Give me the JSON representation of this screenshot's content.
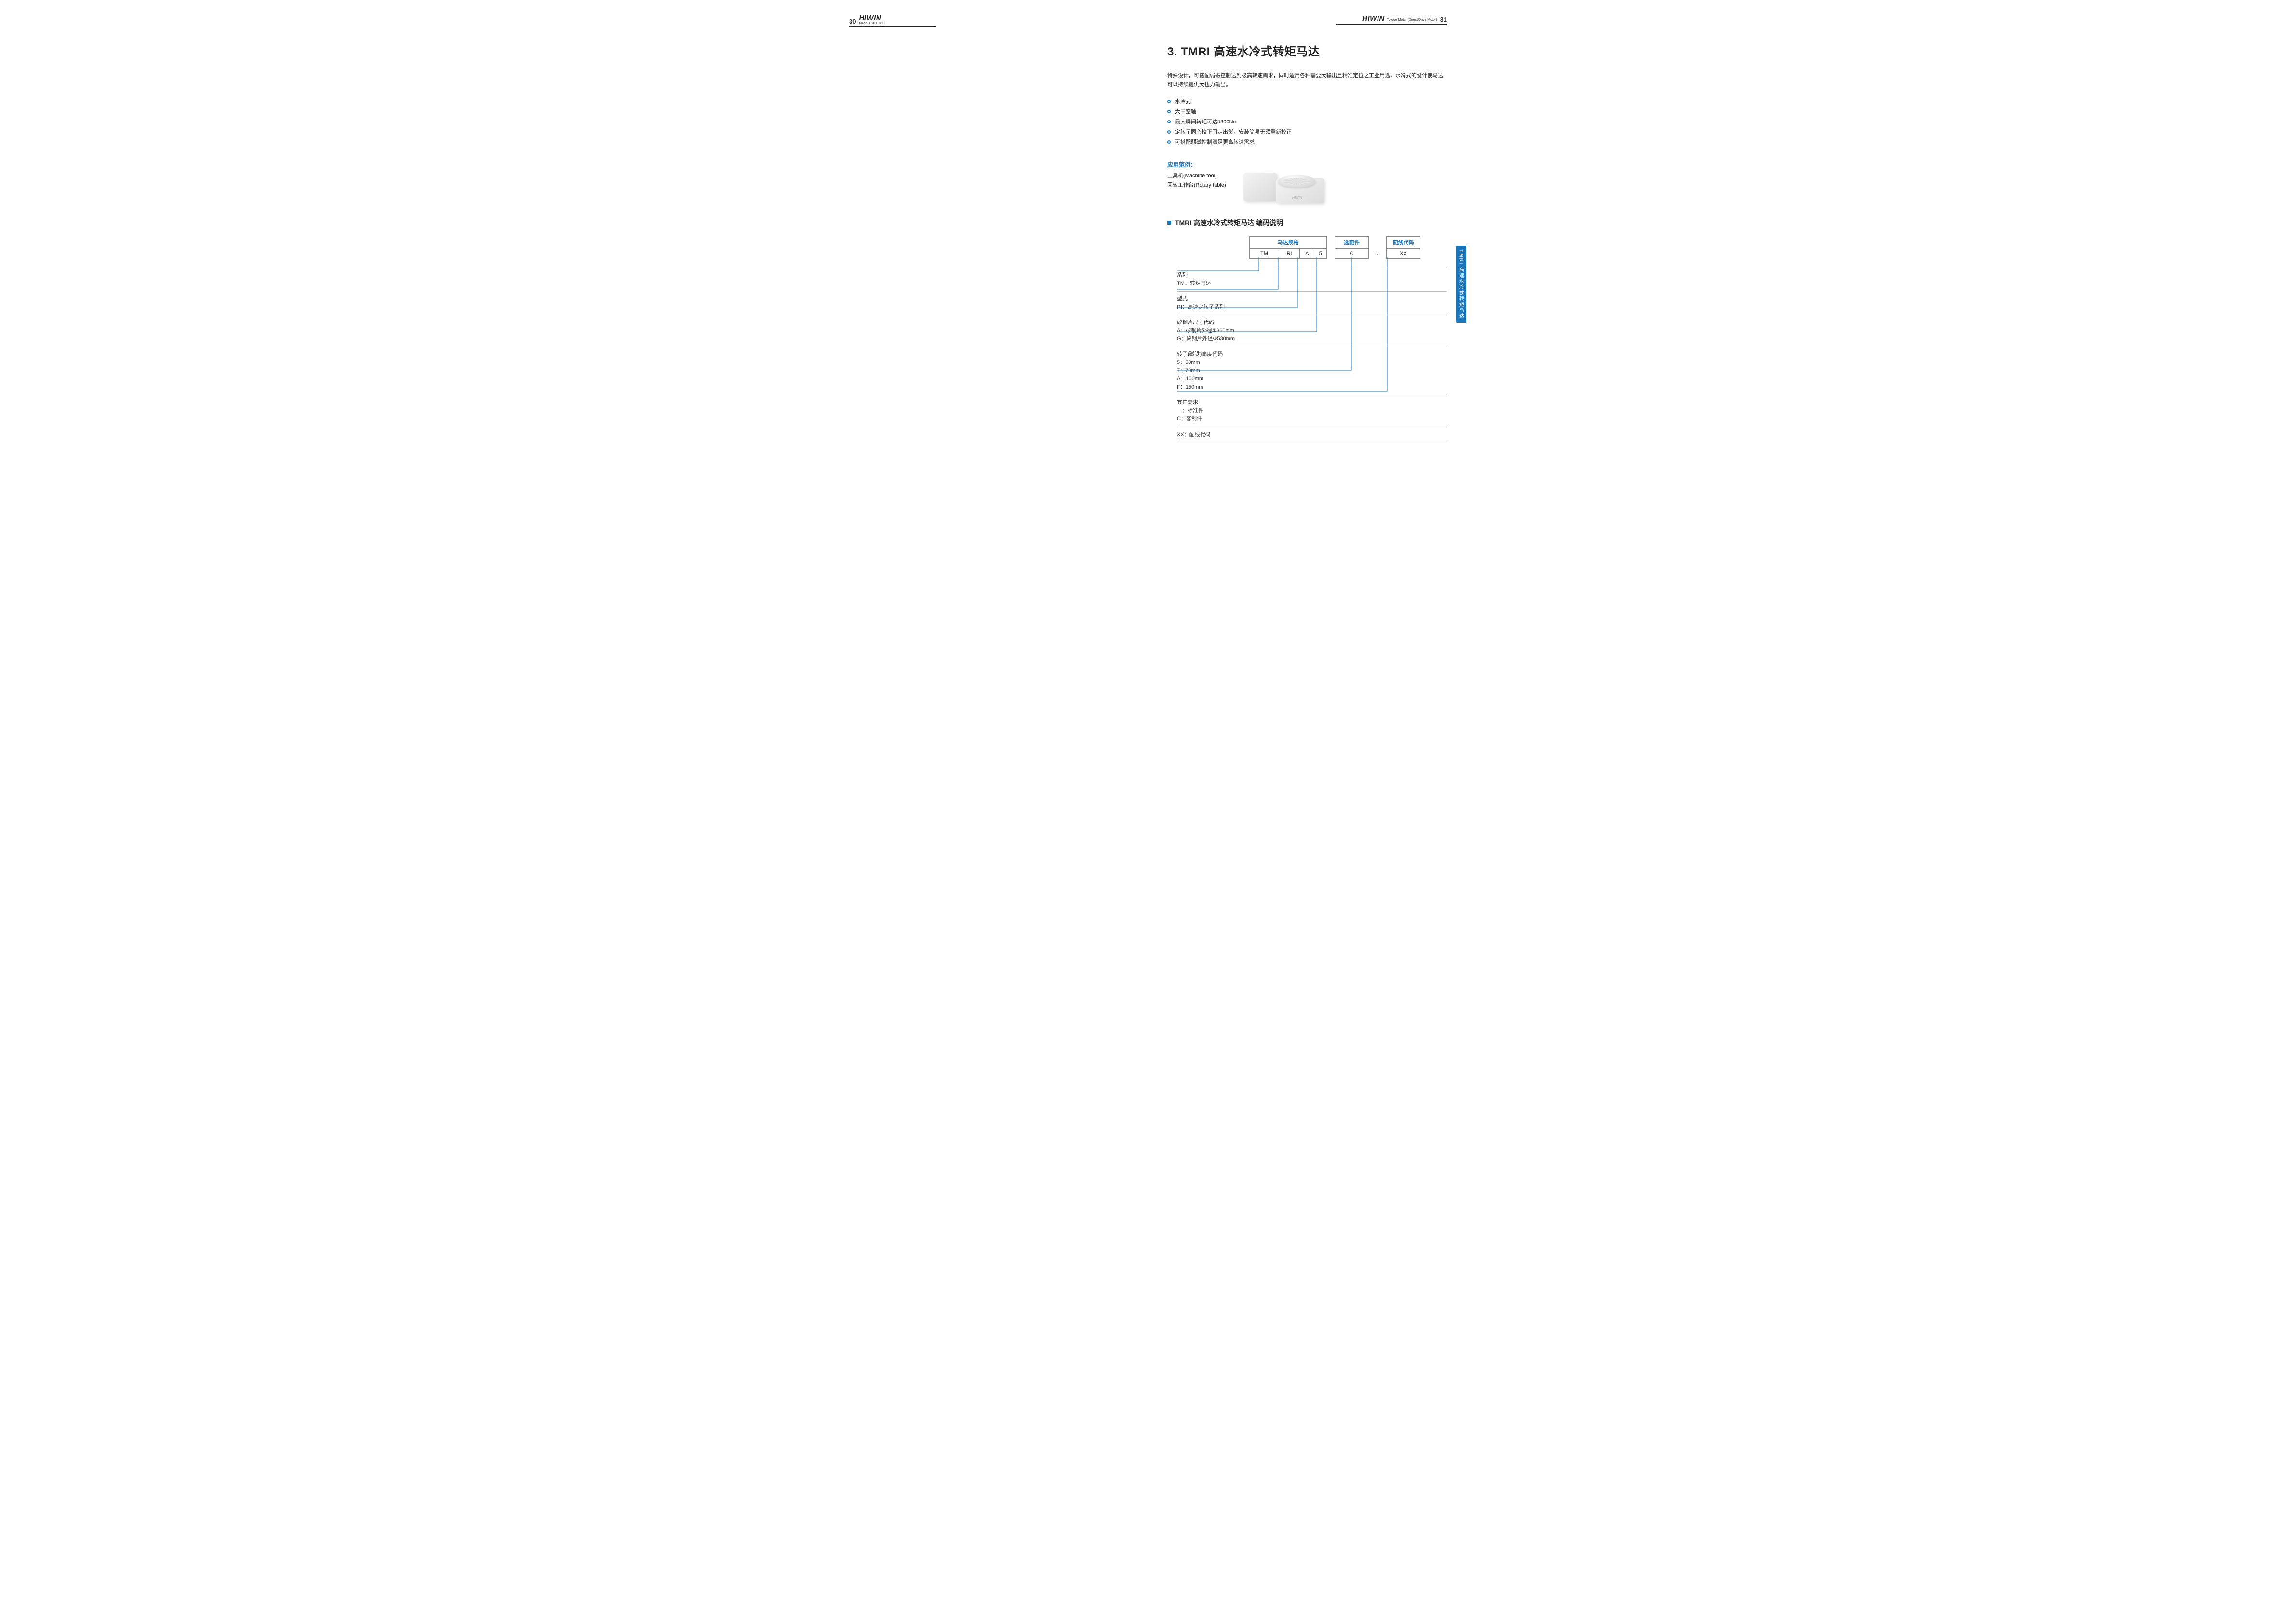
{
  "brand": "HIWIN",
  "left": {
    "page_num": "30",
    "doc_code": "MR99TS01-1800"
  },
  "right": {
    "page_num": "31",
    "subtitle": "Torque Motor (Direct Drive Motor)"
  },
  "section": {
    "title": "3. TMRI 高速水冷式转矩马达",
    "lead": "特殊设计，可搭配弱磁控制达到极高转速需求，同时适用各种需要大输出且精准定位之工业用途，水冷式的设计使马达可以持续提供大扭力输出。",
    "bullets": [
      "水冷式",
      "大中空轴",
      "最大瞬间转矩可达5300Nm",
      "定转子同心校正固定出货，安装简易无须重新校正",
      "可搭配弱磁控制满足更高转速需求"
    ]
  },
  "application": {
    "heading": "应用范例：",
    "lines": [
      "工具机(Machine tool)",
      "回转工作台(Rotary table)"
    ],
    "illus_label": "HIWIN"
  },
  "coding": {
    "subhead": "TMRI 高速水冷式转矩马达 编码说明",
    "groups": {
      "spec": "马达规格",
      "opt": "选配件",
      "wire": "配线代码"
    },
    "cells": {
      "c1": "TM",
      "c2": "RI",
      "c3": "A",
      "c4": "5",
      "opt": "C",
      "wire": "XX"
    },
    "dash": "-",
    "rows": [
      {
        "lbl": "系列",
        "desc": [
          "TM：转矩马达"
        ]
      },
      {
        "lbl": "型式",
        "desc": [
          "RI：高速定转子系列"
        ]
      },
      {
        "lbl": "矽钢片尺寸代码",
        "desc": [
          "A：矽钢片外径Φ360mm",
          "G：矽钢片外径Φ530mm"
        ]
      },
      {
        "lbl": "转子(磁铁)高度代码",
        "desc": [
          "5：50mm",
          "7：70mm",
          "A：100mm",
          "F：150mm"
        ]
      },
      {
        "lbl": "其它需求",
        "desc": [
          "　：标准件",
          "C：客制件"
        ]
      },
      {
        "lbl": "",
        "desc": [
          "XX：配线代码"
        ]
      }
    ]
  },
  "sideTab": "TMRI 高速水冷式转矩马达"
}
